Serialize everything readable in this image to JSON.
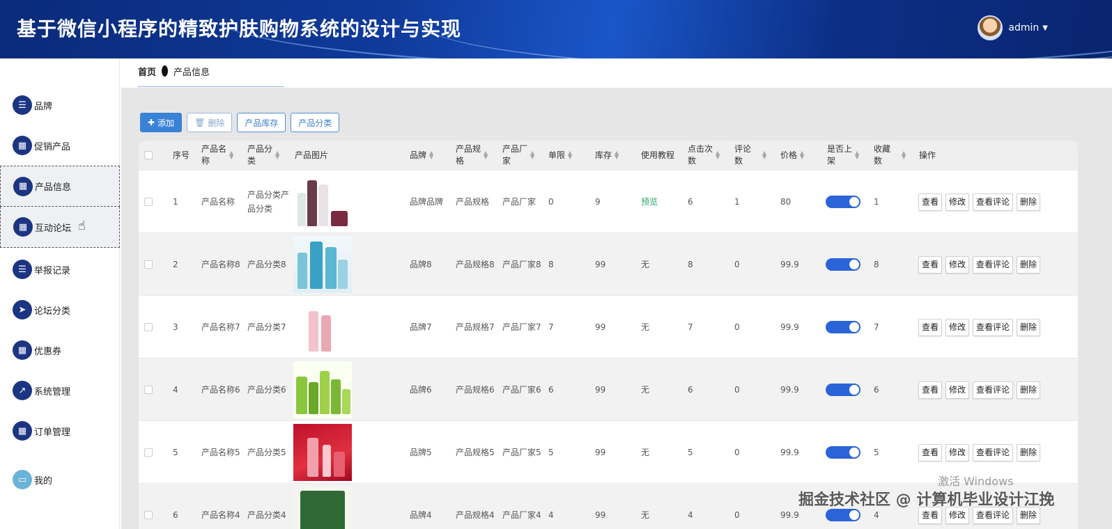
{
  "header": {
    "title": "基于微信小程序的精致护肤购物系统的设计与实现",
    "username": "admin"
  },
  "sidebar": {
    "items": [
      {
        "label": "品牌",
        "icon": "list-icon"
      },
      {
        "label": "促销产品",
        "icon": "grid-icon"
      },
      {
        "label": "产品信息",
        "icon": "grid-icon"
      },
      {
        "label": "互动论坛",
        "icon": "grid-icon"
      },
      {
        "label": "举报记录",
        "icon": "list-icon"
      },
      {
        "label": "论坛分类",
        "icon": "send-icon"
      },
      {
        "label": "优惠券",
        "icon": "grid-icon"
      },
      {
        "label": "系统管理",
        "icon": "chart-icon"
      },
      {
        "label": "订单管理",
        "icon": "grid-icon"
      },
      {
        "label": "我的",
        "icon": "wallet-icon"
      }
    ]
  },
  "breadcrumb": {
    "home": "首页",
    "current": "产品信息"
  },
  "toolbar": {
    "add": "添加",
    "delete": "删除",
    "stock": "产品库存",
    "category": "产品分类"
  },
  "table": {
    "headers": [
      "序号",
      "产品名称",
      "产品分类",
      "产品图片",
      "品牌",
      "产品规格",
      "产品厂家",
      "单限",
      "库存",
      "使用教程",
      "点击次数",
      "评论数",
      "价格",
      "是否上架",
      "收藏数",
      "操作"
    ],
    "header_lines": {
      "name": [
        "产品名",
        "称"
      ],
      "category": [
        "产品分",
        "类"
      ],
      "spec": [
        "产品规",
        "格"
      ],
      "maker": [
        "产品厂",
        "家"
      ],
      "clicks": [
        "点击次",
        "数"
      ],
      "comments": [
        "评论",
        "数"
      ],
      "onsale": [
        "是否上",
        "架"
      ],
      "fav": [
        "收藏",
        "数"
      ]
    },
    "ops": {
      "view": "查看",
      "edit": "修改",
      "view_comments": "查看评论",
      "delete": "删除"
    },
    "rows": [
      {
        "no": "1",
        "name": "产品名称",
        "category": "产品分类产品分类",
        "brand": "品牌品牌",
        "spec": "产品规格",
        "maker": "产品厂家",
        "limit": "0",
        "stock": "9",
        "tutorial": "预览",
        "clicks": "6",
        "comments": "1",
        "price": "80",
        "fav": "1"
      },
      {
        "no": "2",
        "name": "产品名称8",
        "category": "产品分类8",
        "brand": "品牌8",
        "spec": "产品规格8",
        "maker": "产品厂家8",
        "limit": "8",
        "stock": "99",
        "tutorial": "无",
        "clicks": "8",
        "comments": "0",
        "price": "99.9",
        "fav": "8"
      },
      {
        "no": "3",
        "name": "产品名称7",
        "category": "产品分类7",
        "brand": "品牌7",
        "spec": "产品规格7",
        "maker": "产品厂家7",
        "limit": "7",
        "stock": "99",
        "tutorial": "无",
        "clicks": "7",
        "comments": "0",
        "price": "99.9",
        "fav": "7"
      },
      {
        "no": "4",
        "name": "产品名称6",
        "category": "产品分类6",
        "brand": "品牌6",
        "spec": "产品规格6",
        "maker": "产品厂家6",
        "limit": "6",
        "stock": "99",
        "tutorial": "无",
        "clicks": "6",
        "comments": "0",
        "price": "99.9",
        "fav": "6"
      },
      {
        "no": "5",
        "name": "产品名称5",
        "category": "产品分类5",
        "brand": "品牌5",
        "spec": "产品规格5",
        "maker": "产品厂家5",
        "limit": "5",
        "stock": "99",
        "tutorial": "无",
        "clicks": "5",
        "comments": "0",
        "price": "99.9",
        "fav": "5"
      },
      {
        "no": "6",
        "name": "产品名称4",
        "category": "产品分类4",
        "brand": "品牌4",
        "spec": "产品规格4",
        "maker": "产品厂家4",
        "limit": "4",
        "stock": "99",
        "tutorial": "无",
        "clicks": "4",
        "comments": "0",
        "price": "99.9",
        "fav": "4"
      }
    ]
  },
  "watermarks": {
    "windows": "激活 Windows",
    "site": "掘金技术社区 @ 计算机毕业设计江挽"
  },
  "colors": {
    "header": "#0f3a9a",
    "sidebar_icon": "#1b3583",
    "primary": "#3a82d6",
    "toggle_on": "#2b64d8",
    "tutorial_link": "#2aa56a"
  }
}
